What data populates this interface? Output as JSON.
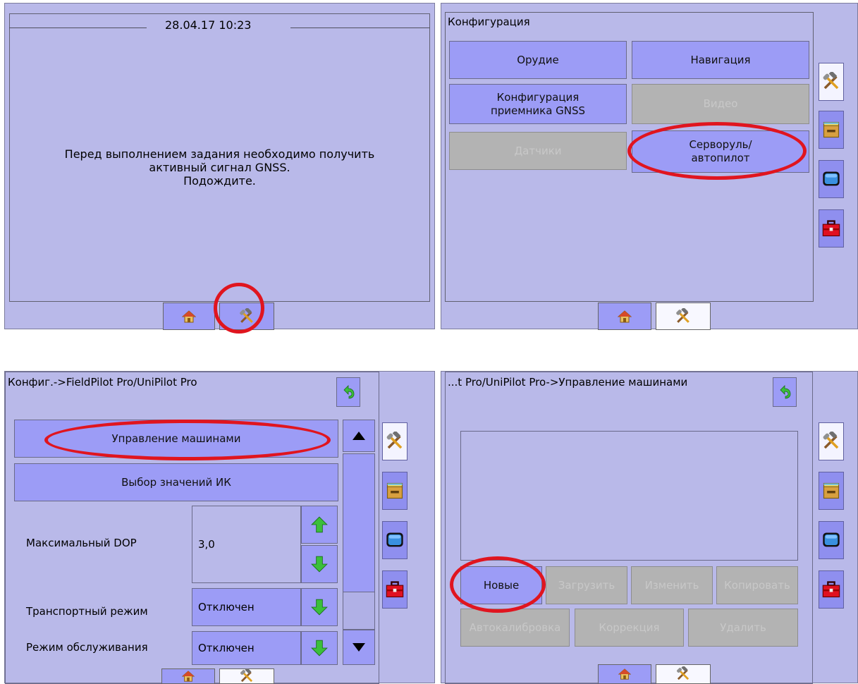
{
  "colors": {
    "panel": "#b9b9e9",
    "button": "#9c9cf6",
    "disabled": "#b3b3b3",
    "highlight": "#e0151f"
  },
  "screen1": {
    "datetime": "28.04.17 10:23",
    "message_line1": "Перед выполнением задания необходимо получить",
    "message_line2": "активный сигнал GNSS.",
    "message_line3": "Подождите."
  },
  "screen2": {
    "title": "Конфигурация",
    "buttons": {
      "implement": "Орудие",
      "navigation": "Навигация",
      "gnss_line1": "Конфигурация",
      "gnss_line2": "приемника GNSS",
      "video": "Видео",
      "sensors": "Датчики",
      "steering_line1": "Серворуль/",
      "steering_line2": "автопилот"
    }
  },
  "screen3": {
    "title": "Конфиг.->FieldPilot Pro/UniPilot Pro",
    "buttons": {
      "machine_control": "Управление машинами",
      "ik_values": "Выбор значений ИК"
    },
    "rows": {
      "max_dop_label": "Максимальный DOP",
      "max_dop_value": "3,0",
      "transport_label": "Транспортный режим",
      "transport_value": "Отключен",
      "service_label": "Режим обслуживания",
      "service_value": "Отключен"
    }
  },
  "screen4": {
    "title": "...t Pro/UniPilot Pro->Управление машинами",
    "buttons": {
      "new": "Новые",
      "load": "Загрузить",
      "edit": "Изменить",
      "copy": "Копировать",
      "autocal": "Автокалибровка",
      "correction": "Коррекция",
      "delete": "Удалить"
    }
  },
  "icons": [
    "home-icon",
    "tools-icon",
    "database-icon",
    "display-icon",
    "toolbox-icon",
    "back-arrow-icon",
    "arrow-up-icon",
    "arrow-down-icon"
  ]
}
